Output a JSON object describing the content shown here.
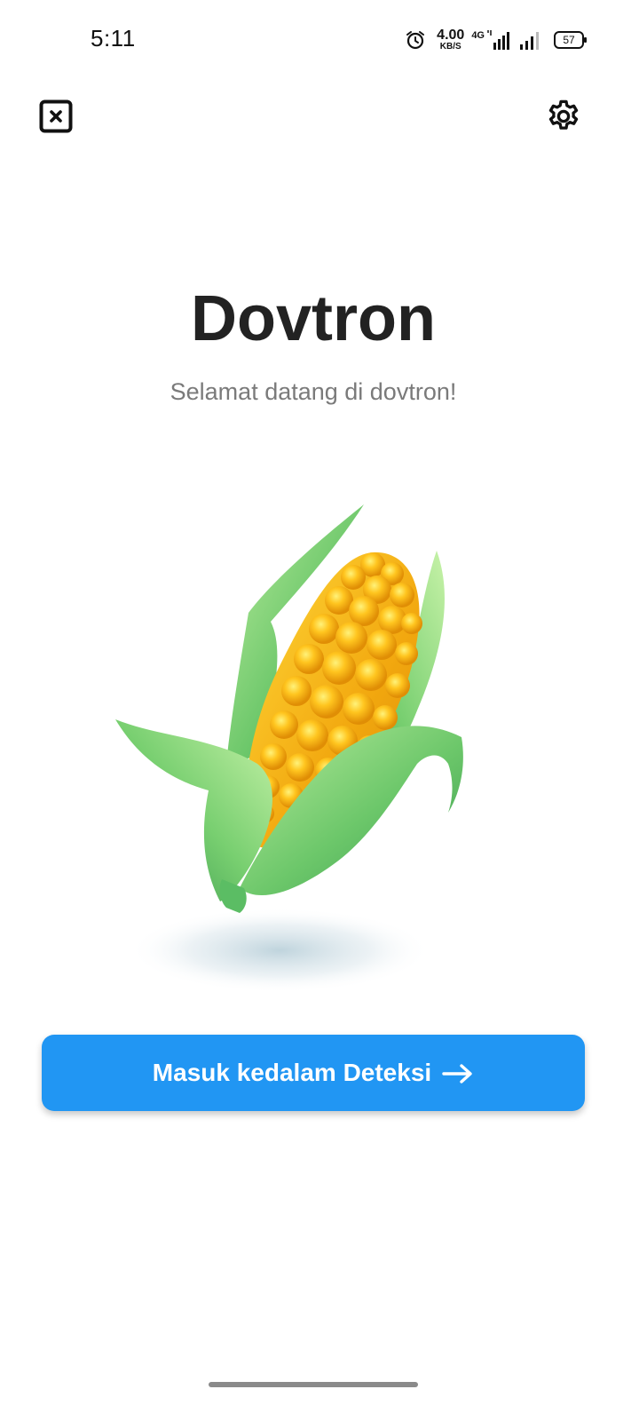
{
  "status_bar": {
    "time": "5:11",
    "net_speed_value": "4.00",
    "net_speed_unit": "KB/S",
    "network_type": "4G",
    "battery_level": "57",
    "icons": [
      "alarm-icon",
      "signal-icon",
      "signal-icon",
      "battery-icon"
    ]
  },
  "toolbar": {
    "close_icon": "close-square-icon",
    "settings_icon": "gear-icon"
  },
  "main": {
    "title": "Dovtron",
    "subtitle": "Selamat datang di dovtron!",
    "illustration": "corn-illustration"
  },
  "cta": {
    "label": "Masuk kedalam Deteksi",
    "icon": "arrow-right-icon",
    "color": "#2196f3"
  }
}
